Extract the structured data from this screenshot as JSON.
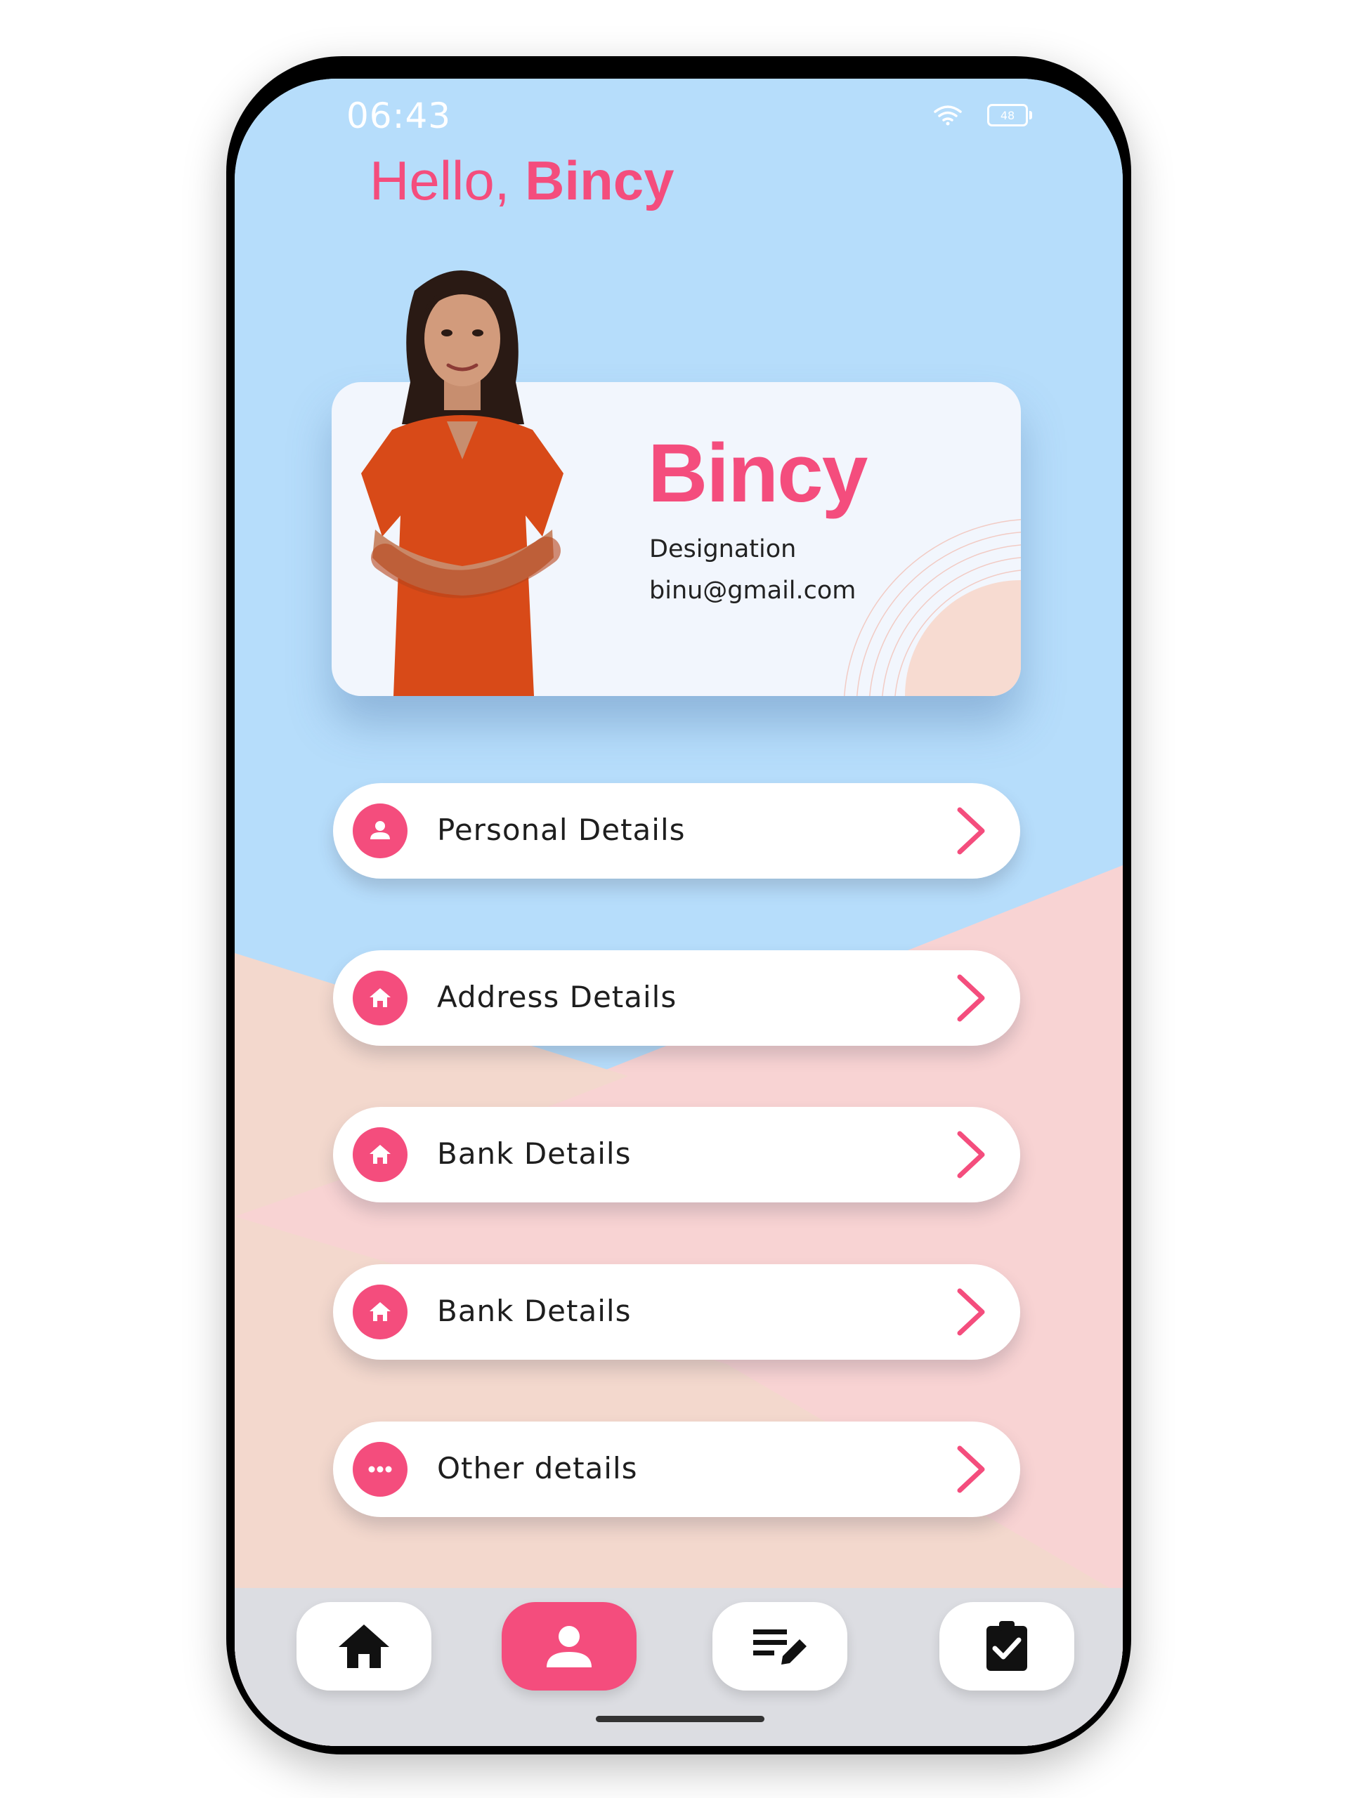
{
  "status_bar": {
    "time": "06:43",
    "battery": "48"
  },
  "greeting": {
    "prefix": "Hello, ",
    "name": "Bincy"
  },
  "profile": {
    "name": "Bincy",
    "designation": "Designation",
    "email": "binu@gmail.com"
  },
  "menu": [
    {
      "label": "Personal Details",
      "icon": "person-icon"
    },
    {
      "label": "Address Details",
      "icon": "home-icon"
    },
    {
      "label": "Bank Details",
      "icon": "home-icon"
    },
    {
      "label": "Bank Details",
      "icon": "home-icon"
    },
    {
      "label": "Other details",
      "icon": "more-horizontal-icon"
    }
  ],
  "nav": [
    {
      "name": "home-icon",
      "active": false
    },
    {
      "name": "person-icon",
      "active": true
    },
    {
      "name": "edit-list-icon",
      "active": false
    },
    {
      "name": "clipboard-check-icon",
      "active": false
    }
  ],
  "colors": {
    "accent": "#f44d7d",
    "sky": "#b6ddfb",
    "peach": "#f3d8cd",
    "pink": "#f8d3d3",
    "nav_bg": "#dcdde2"
  }
}
